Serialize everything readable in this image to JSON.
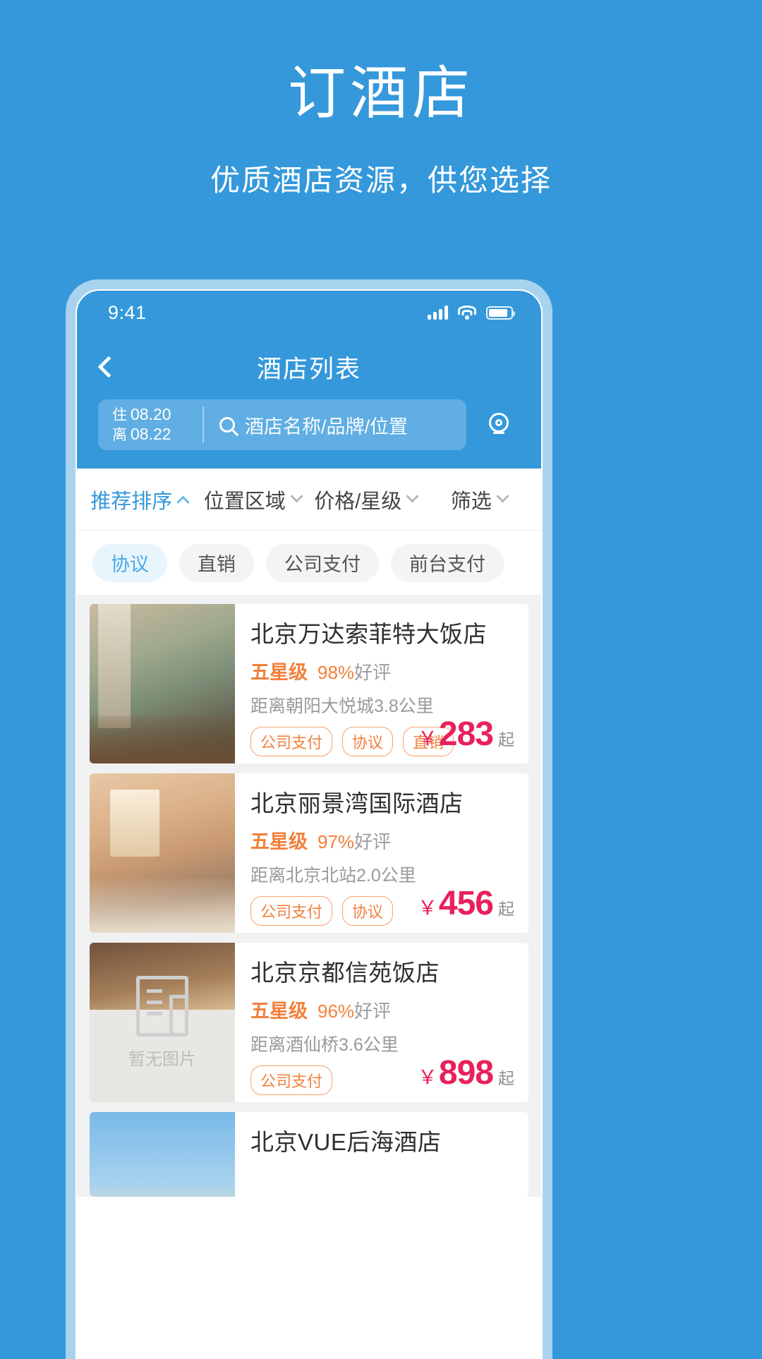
{
  "promo": {
    "title": "订酒店",
    "subtitle": "优质酒店资源，供您选择"
  },
  "colors": {
    "brand_blue": "#3498db",
    "bezel_blue": "#a8d3ef",
    "accent_orange": "#f2803b",
    "price_pink": "#e8215b",
    "chip_active_bg": "#e8f5fd",
    "chip_active_text": "#4aa9e8"
  },
  "statusbar": {
    "time": "9:41",
    "icons": [
      "signal-bars-icon",
      "wifi-icon",
      "battery-icon"
    ]
  },
  "navbar": {
    "back_icon": "chevron-left-icon",
    "title": "酒店列表"
  },
  "search": {
    "checkin_label": "住",
    "checkin_date": "08.20",
    "checkout_label": "离",
    "checkout_date": "08.22",
    "search_icon": "search-icon",
    "placeholder": "酒店名称/品牌/位置",
    "map_icon": "map-pin-icon"
  },
  "filters": [
    {
      "label": "推荐排序",
      "active": true,
      "caret": "chevron-up-icon"
    },
    {
      "label": "位置区域",
      "active": false,
      "caret": "chevron-down-icon"
    },
    {
      "label": "价格/星级",
      "active": false,
      "caret": "chevron-down-icon"
    },
    {
      "label": "筛选",
      "active": false,
      "caret": "chevron-down-icon"
    }
  ],
  "chips": [
    {
      "label": "协议",
      "active": true
    },
    {
      "label": "直销",
      "active": false
    },
    {
      "label": "公司支付",
      "active": false
    },
    {
      "label": "前台支付",
      "active": false
    }
  ],
  "hotels": [
    {
      "name": "北京万达索菲特大饭店",
      "star": "五星级",
      "rating": "98%",
      "rating_suffix": "好评",
      "distance": "距离朝阳大悦城3.8公里",
      "tags": [
        "公司支付",
        "协议",
        "直销"
      ],
      "currency": "￥",
      "price": "283",
      "price_suffix": "起",
      "thumb": "hotel-exterior-photo"
    },
    {
      "name": "北京丽景湾国际酒店",
      "star": "五星级",
      "rating": "97%",
      "rating_suffix": "好评",
      "distance": "距离北京北站2.0公里",
      "tags": [
        "公司支付",
        "协议"
      ],
      "currency": "￥",
      "price": "456",
      "price_suffix": "起",
      "thumb": "hotel-room-photo"
    },
    {
      "name": "北京京都信苑饭店",
      "star": "五星级",
      "rating": "96%",
      "rating_suffix": "好评",
      "distance": "距离酒仙桥3.6公里",
      "tags": [
        "公司支付"
      ],
      "currency": "￥",
      "price": "898",
      "price_suffix": "起",
      "thumb": "no-image-placeholder",
      "thumb_text": "暂无图片"
    },
    {
      "name": "北京VUE后海酒店",
      "thumb": "hotel-sky-photo"
    }
  ]
}
